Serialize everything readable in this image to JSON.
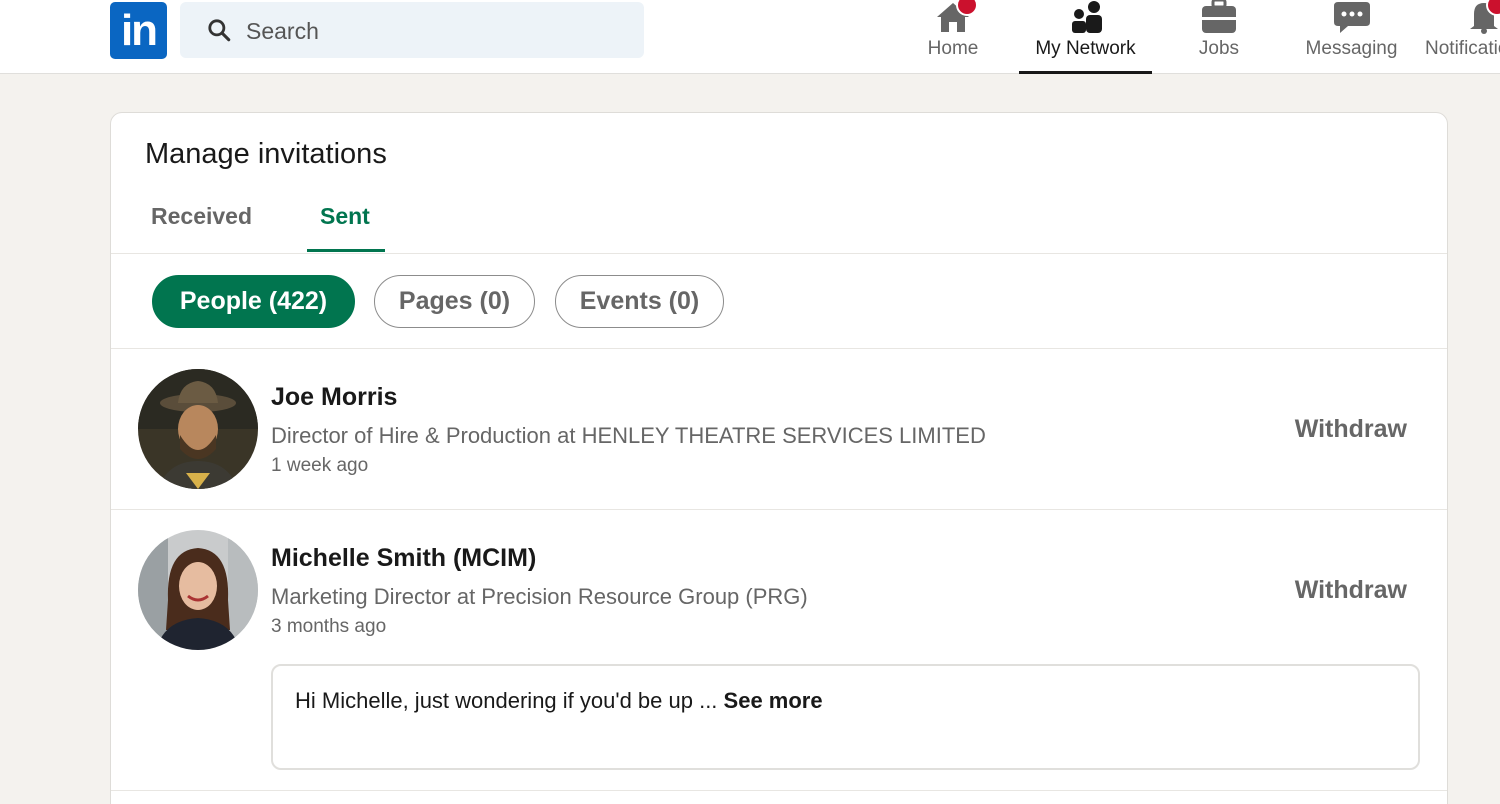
{
  "nav": {
    "logo_text": "in",
    "search_placeholder": "Search",
    "items": [
      {
        "label": "Home",
        "icon": "home-icon"
      },
      {
        "label": "My Network",
        "icon": "network-icon",
        "active": true
      },
      {
        "label": "Jobs",
        "icon": "briefcase-icon"
      },
      {
        "label": "Messaging",
        "icon": "messaging-icon"
      },
      {
        "label": "Notifications",
        "icon": "bell-icon"
      }
    ]
  },
  "page": {
    "title": "Manage invitations",
    "tabs": [
      {
        "label": "Received"
      },
      {
        "label": "Sent",
        "active": true
      }
    ],
    "filters": [
      {
        "label": "People (422)",
        "active": true
      },
      {
        "label": "Pages (0)"
      },
      {
        "label": "Events (0)"
      }
    ]
  },
  "invitations": [
    {
      "name": "Joe Morris",
      "headline": "Director of Hire & Production at HENLEY THEATRE SERVICES LIMITED",
      "time": "1 week ago",
      "action": "Withdraw"
    },
    {
      "name": "Michelle Smith (MCIM)",
      "headline": "Marketing Director at Precision Resource Group (PRG)",
      "time": "3 months ago",
      "action": "Withdraw",
      "message": "Hi Michelle, just wondering if you'd be up ...",
      "see_more": "See more"
    }
  ],
  "colors": {
    "brand_blue": "#0a66c2",
    "accent_green": "#01754f",
    "badge_red": "#cb112d"
  }
}
